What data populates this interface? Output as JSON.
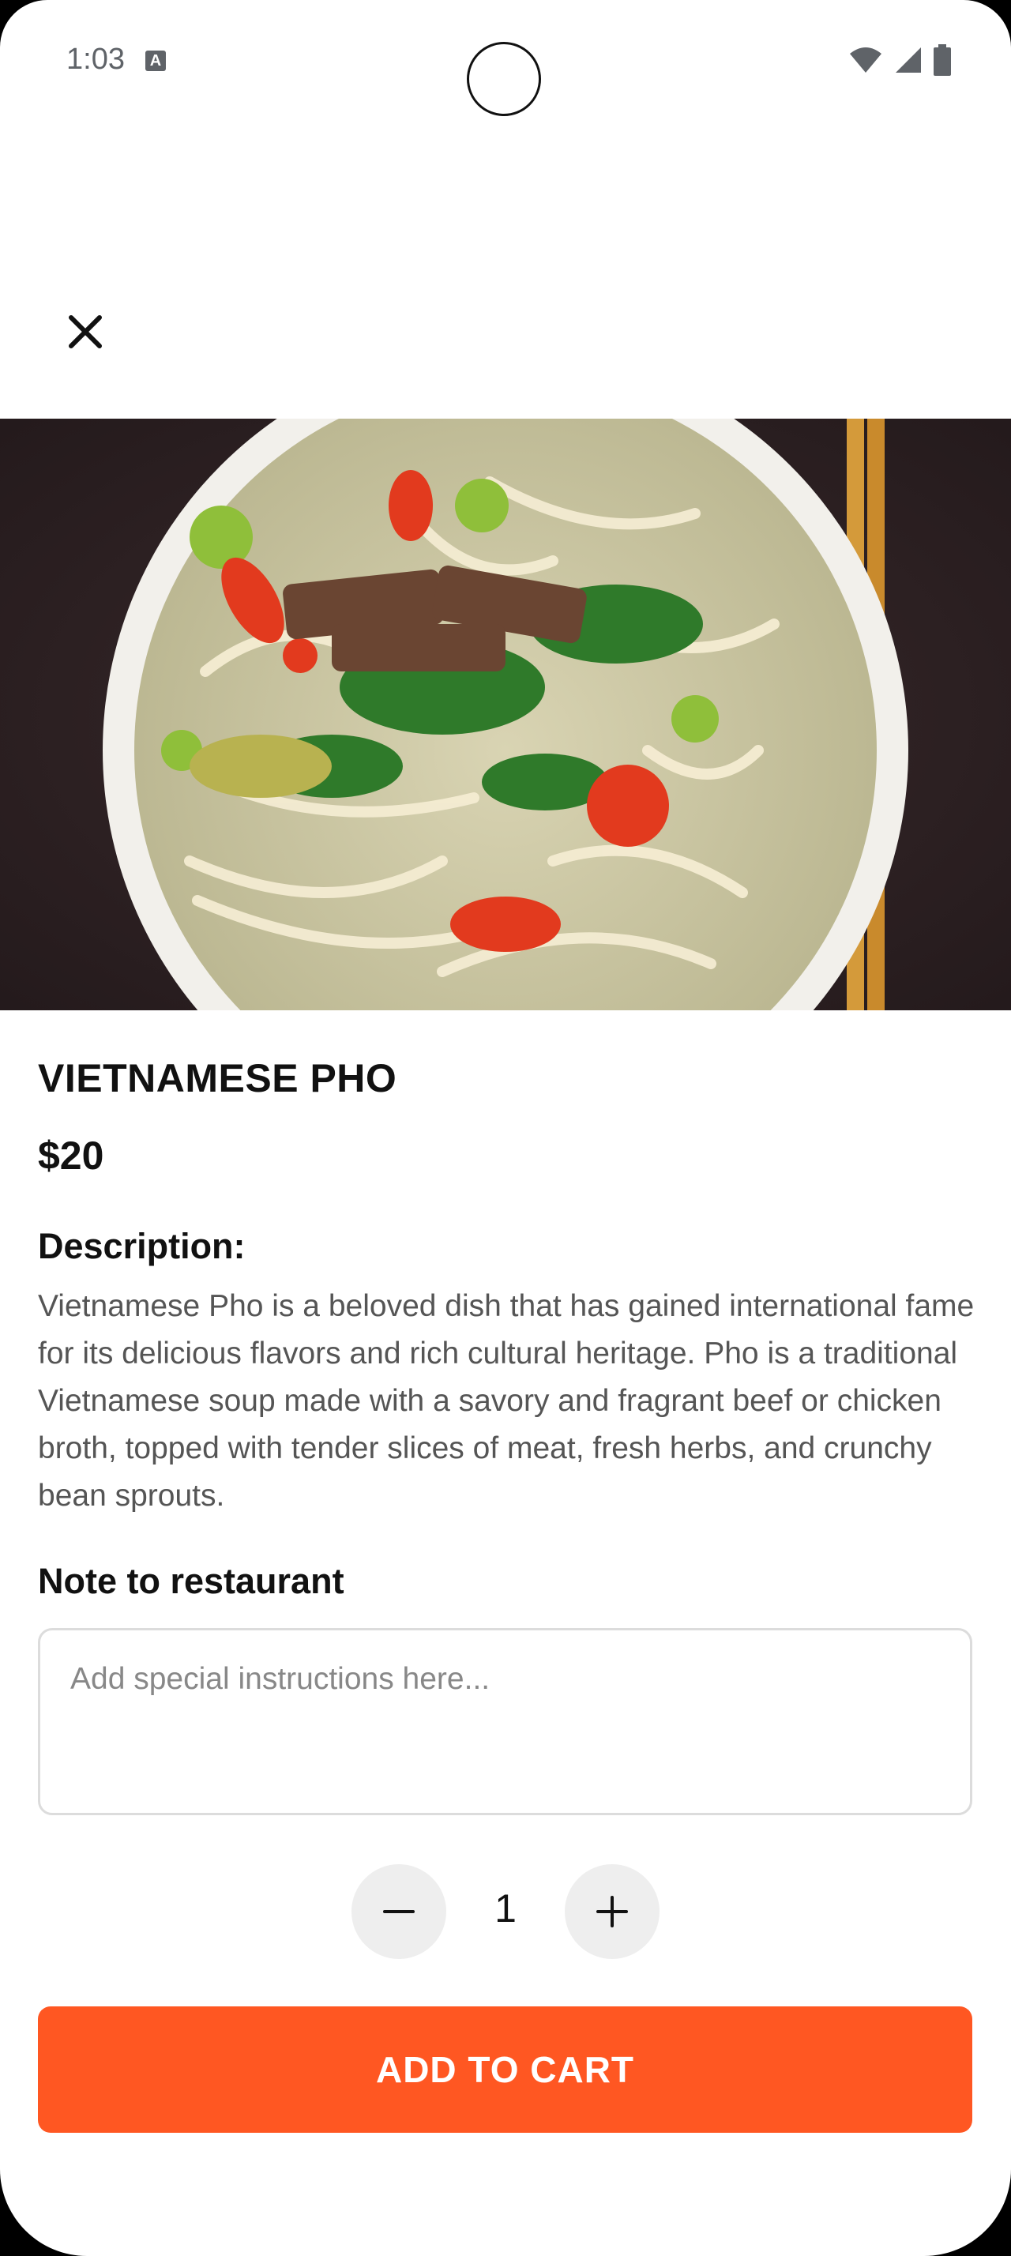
{
  "status_bar": {
    "time": "1:03",
    "notification_glyph": "A"
  },
  "header": {
    "close_icon": "close-icon"
  },
  "product": {
    "image": "vietnamese-pho-bowl",
    "name": "VIETNAMESE PHO",
    "price": "$20",
    "description_label": "Description:",
    "description": "Vietnamese Pho is a beloved dish that has gained international fame for its delicious flavors and rich cultural heritage. Pho is a traditional Vietnamese soup made with a savory and fragrant beef or chicken broth, topped with tender slices of meat, fresh herbs, and crunchy bean sprouts."
  },
  "note": {
    "label": "Note to restaurant",
    "placeholder": "Add special instructions here...",
    "value": ""
  },
  "quantity": {
    "value": "1",
    "decrement_icon": "minus-icon",
    "increment_icon": "plus-icon"
  },
  "actions": {
    "add_to_cart_label": "ADD TO CART"
  },
  "colors": {
    "accent": "#ff5722",
    "qty_button_bg": "#eeeeee",
    "text_primary": "#111111",
    "text_secondary": "#555555"
  }
}
